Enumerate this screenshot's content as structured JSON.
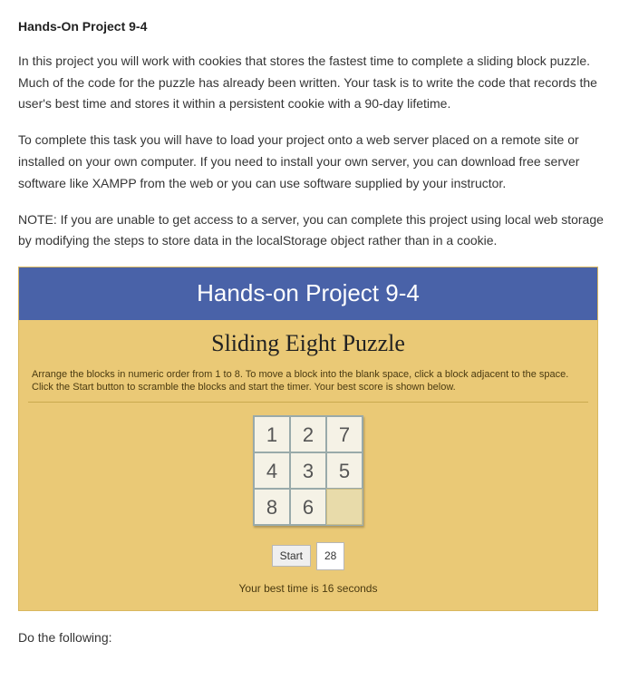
{
  "heading": "Hands-On Project 9-4",
  "paragraphs": {
    "p1": "In this project you will work with cookies that stores the fastest time to complete a sliding block puzzle. Much of the code for the puzzle has already been written. Your task is to write the code that records the user's best time and stores it within a persistent cookie with a 90-day lifetime.",
    "p2": "To complete this task you will have to load your project onto a web server placed on a remote site or installed on your own computer. If you need to install your own server, you can download free server software like XAMPP from the web or you can use software supplied by your instructor.",
    "p3": "NOTE: If you are unable to get access to a server, you can complete this project using local web storage by modifying the steps to store data in the localStorage object rather than in a cookie."
  },
  "app": {
    "header": "Hands-on Project 9-4",
    "subtitle": "Sliding Eight Puzzle",
    "instructions": "Arrange the blocks in numeric order from 1 to 8. To move a block into the blank space, click a block adjacent to the space. Click the Start button to scramble the blocks and start the timer. Your best score is shown below.",
    "tiles": [
      "1",
      "2",
      "7",
      "4",
      "3",
      "5",
      "8",
      "6",
      ""
    ],
    "start_label": "Start",
    "timer_value": "28",
    "best_time_text": "Your best time is 16 seconds"
  },
  "followup": "Do the following:"
}
